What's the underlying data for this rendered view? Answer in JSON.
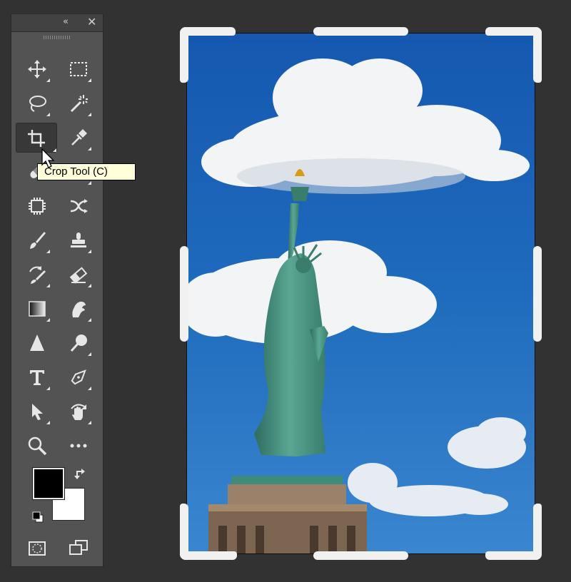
{
  "panel": {
    "collapse_glyph": "«",
    "close_glyph": "✕"
  },
  "tools": [
    {
      "name": "move-tool",
      "icon": "move-icon"
    },
    {
      "name": "rectangular-marquee-tool",
      "icon": "rect-marquee-icon"
    },
    {
      "name": "lasso-tool",
      "icon": "lasso-icon"
    },
    {
      "name": "magic-wand-tool",
      "icon": "magic-wand-icon"
    },
    {
      "name": "crop-tool",
      "icon": "crop-icon",
      "selected": true
    },
    {
      "name": "eyedropper-tool",
      "icon": "eyedropper-icon"
    },
    {
      "name": "spot-healing-brush-tool",
      "icon": "healing-brush-icon"
    },
    {
      "name": "brush-tool",
      "icon": "brush-icon"
    },
    {
      "name": "content-aware-move-tool",
      "icon": "content-aware-icon"
    },
    {
      "name": "puppet-warp-tool",
      "icon": "puppet-warp-icon"
    },
    {
      "name": "paintbrush-tool",
      "icon": "paintbrush-icon"
    },
    {
      "name": "clone-stamp-tool",
      "icon": "stamp-icon"
    },
    {
      "name": "history-brush-tool",
      "icon": "history-brush-icon"
    },
    {
      "name": "eraser-tool",
      "icon": "eraser-icon"
    },
    {
      "name": "gradient-tool",
      "icon": "gradient-icon"
    },
    {
      "name": "smudge-tool",
      "icon": "smudge-icon"
    },
    {
      "name": "sharpen-tool",
      "icon": "sharpen-icon"
    },
    {
      "name": "dodge-tool",
      "icon": "dodge-icon"
    },
    {
      "name": "type-tool",
      "icon": "type-icon"
    },
    {
      "name": "pen-tool",
      "icon": "pen-icon"
    },
    {
      "name": "path-selection-tool",
      "icon": "arrow-icon"
    },
    {
      "name": "rotate-view-tool",
      "icon": "hand-rotate-icon"
    },
    {
      "name": "zoom-tool",
      "icon": "magnifier-icon"
    },
    {
      "name": "edit-toolbar",
      "icon": "ellipsis-icon"
    },
    {
      "name": "quick-mask-mode",
      "icon": "quick-mask-icon"
    },
    {
      "name": "screen-mode",
      "icon": "screen-mode-icon"
    }
  ],
  "colors": {
    "foreground": "#000000",
    "background": "#ffffff",
    "swap_icon": "swap-icon",
    "reset_icon": "default-colors-icon"
  },
  "tooltip": {
    "text": "Crop Tool (C)"
  },
  "canvas": {
    "subject": "statue-of-liberty-photo",
    "sky_color": "#1f6bbd",
    "statue_color": "#4f9a86"
  }
}
